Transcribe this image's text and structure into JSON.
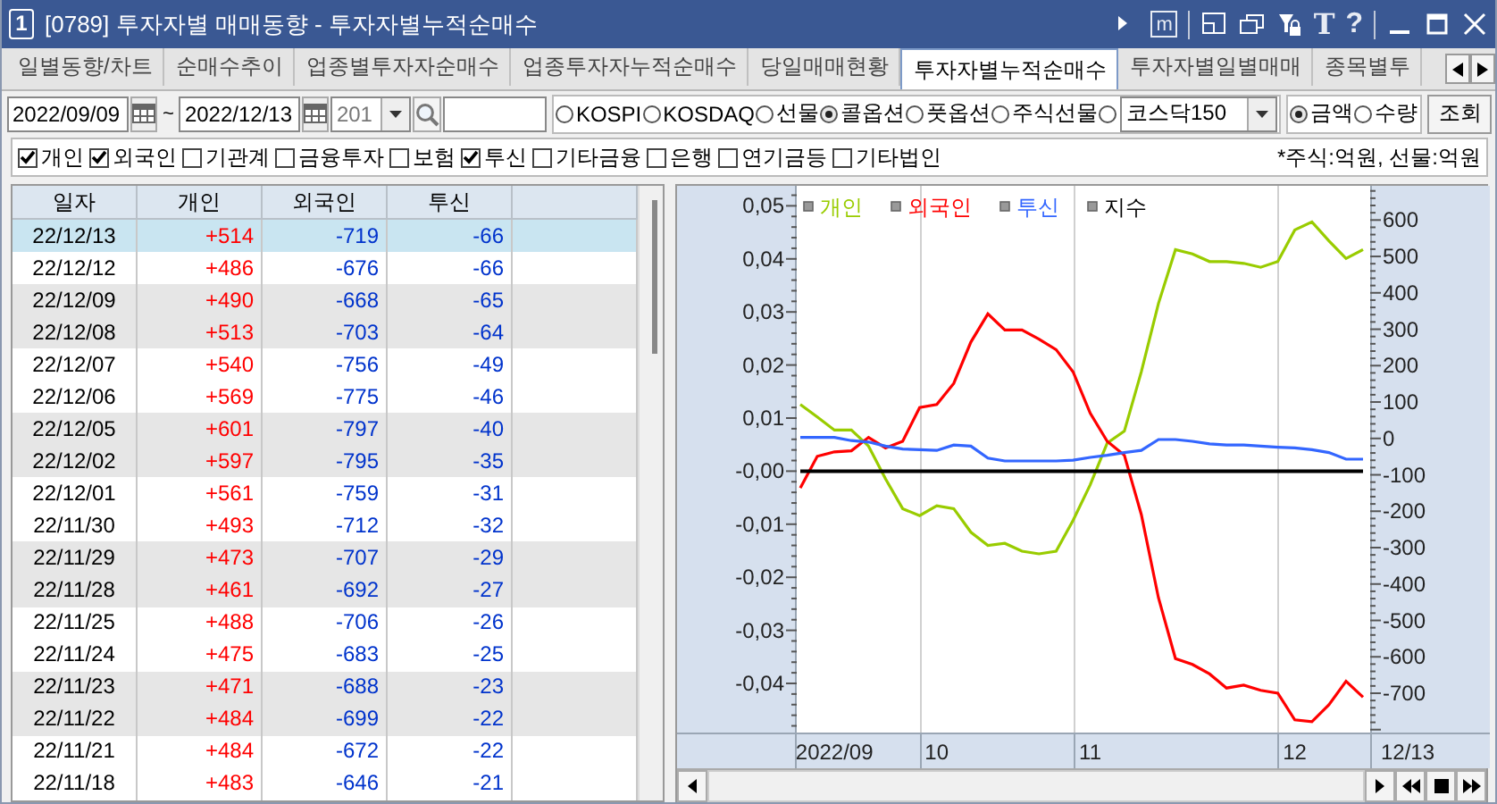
{
  "window": {
    "number": "1",
    "title": "[0789] 투자자별 매매동향 - 투자자별누적순매수",
    "tools": [
      {
        "kind": "play"
      },
      {
        "kind": "memo",
        "label": "m"
      },
      {
        "kind": "sep"
      },
      {
        "kind": "layout"
      },
      {
        "kind": "copy"
      },
      {
        "kind": "lock"
      },
      {
        "kind": "font",
        "label": "T"
      },
      {
        "kind": "help",
        "label": "?"
      },
      {
        "kind": "sep"
      },
      {
        "kind": "minimize"
      },
      {
        "kind": "maximize"
      },
      {
        "kind": "close"
      }
    ]
  },
  "tabs": [
    {
      "label": "일별동향/차트",
      "selected": false
    },
    {
      "label": "순매수추이",
      "selected": false
    },
    {
      "label": "업종별투자자순매수",
      "selected": false
    },
    {
      "label": "업종투자자누적순매수",
      "selected": false
    },
    {
      "label": "당일매매현황",
      "selected": false
    },
    {
      "label": "투자자별누적순매수",
      "selected": true
    },
    {
      "label": "투자자별일별매매",
      "selected": false
    },
    {
      "label": "종목별투",
      "selected": false
    }
  ],
  "toolbar": {
    "start_date": "2022/09/09",
    "separator": "~",
    "end_date": "2022/12/13",
    "code": "201",
    "markets": [
      {
        "label": "KOSPI",
        "selected": false
      },
      {
        "label": "KOSDAQ",
        "selected": false
      },
      {
        "label": "선물",
        "selected": false
      },
      {
        "label": "콜옵션",
        "selected": true
      },
      {
        "label": "풋옵션",
        "selected": false
      },
      {
        "label": "주식선물",
        "selected": false
      },
      {
        "kind": "combo",
        "value": "코스닥150",
        "selected": false
      }
    ],
    "units": [
      {
        "label": "금액",
        "selected": true
      },
      {
        "label": "수량",
        "selected": false
      }
    ],
    "search_button": "조회"
  },
  "investors": [
    {
      "label": "개인",
      "checked": true
    },
    {
      "label": "외국인",
      "checked": true
    },
    {
      "label": "기관계",
      "checked": false
    },
    {
      "label": "금융투자",
      "checked": false
    },
    {
      "label": "보험",
      "checked": false
    },
    {
      "label": "투신",
      "checked": true
    },
    {
      "label": "기타금융",
      "checked": false
    },
    {
      "label": "은행",
      "checked": false
    },
    {
      "label": "연기금등",
      "checked": false
    },
    {
      "label": "기타법인",
      "checked": false
    }
  ],
  "unit_note": "*주식:억원, 선물:억원",
  "table": {
    "columns": [
      {
        "label": "일자",
        "color": "#000000"
      },
      {
        "label": "개인",
        "color": "#ff0000"
      },
      {
        "label": "외국인",
        "color": "#0033cc"
      },
      {
        "label": "투신",
        "color": "#0033cc"
      }
    ],
    "rows": [
      {
        "selected": true,
        "cells": [
          "22/12/13",
          "+514",
          "-719",
          "-66"
        ]
      },
      {
        "selected": false,
        "cells": [
          "22/12/12",
          "+486",
          "-676",
          "-66"
        ]
      },
      {
        "selected": false,
        "cells": [
          "22/12/09",
          "+490",
          "-668",
          "-65"
        ]
      },
      {
        "selected": false,
        "cells": [
          "22/12/08",
          "+513",
          "-703",
          "-64"
        ]
      },
      {
        "selected": false,
        "cells": [
          "22/12/07",
          "+540",
          "-756",
          "-49"
        ]
      },
      {
        "selected": false,
        "cells": [
          "22/12/06",
          "+569",
          "-775",
          "-46"
        ]
      },
      {
        "selected": false,
        "cells": [
          "22/12/05",
          "+601",
          "-797",
          "-40"
        ]
      },
      {
        "selected": false,
        "cells": [
          "22/12/02",
          "+597",
          "-795",
          "-35"
        ]
      },
      {
        "selected": false,
        "cells": [
          "22/12/01",
          "+561",
          "-759",
          "-31"
        ]
      },
      {
        "selected": false,
        "cells": [
          "22/11/30",
          "+493",
          "-712",
          "-32"
        ]
      },
      {
        "selected": false,
        "cells": [
          "22/11/29",
          "+473",
          "-707",
          "-29"
        ]
      },
      {
        "selected": false,
        "cells": [
          "22/11/28",
          "+461",
          "-692",
          "-27"
        ]
      },
      {
        "selected": false,
        "cells": [
          "22/11/25",
          "+488",
          "-706",
          "-26"
        ]
      },
      {
        "selected": false,
        "cells": [
          "22/11/24",
          "+475",
          "-683",
          "-25"
        ]
      },
      {
        "selected": false,
        "cells": [
          "22/11/23",
          "+471",
          "-688",
          "-23"
        ]
      },
      {
        "selected": false,
        "cells": [
          "22/11/22",
          "+484",
          "-699",
          "-22"
        ]
      },
      {
        "selected": false,
        "cells": [
          "22/11/21",
          "+484",
          "-672",
          "-22"
        ]
      },
      {
        "selected": false,
        "cells": [
          "22/11/18",
          "+483",
          "-646",
          "-21"
        ]
      }
    ]
  },
  "chart": {
    "left_axis_labels": [
      "0,05",
      "0,04",
      "0,03",
      "0,02",
      "0,01",
      "-0,00",
      "-0,01",
      "-0,02",
      "-0,03",
      "-0,04"
    ],
    "end_label": "12/13",
    "chart_data": {
      "type": "line",
      "categories": [
        null,
        null,
        "2022/09",
        null,
        null,
        null,
        null,
        null,
        "10",
        null,
        null,
        null,
        null,
        null,
        null,
        null,
        null,
        "11",
        null,
        null,
        null,
        null,
        null,
        null,
        null,
        null,
        null,
        null,
        null,
        "12",
        null,
        null,
        null,
        null
      ],
      "ylim": [
        -808,
        694
      ],
      "grid": true,
      "yticks": [
        600,
        500,
        400,
        300,
        200,
        100,
        0,
        -100,
        -200,
        -300,
        -400,
        -500,
        -600,
        -700
      ],
      "series": [
        {
          "name": "개인",
          "color": "#99cc00",
          "values": [
            93,
            59,
            23,
            23,
            -21,
            -111,
            -193,
            -212,
            -185,
            -193,
            -258,
            -294,
            -288,
            -310,
            -317,
            -310,
            -225,
            -127,
            -13,
            20,
            183,
            371,
            519,
            507,
            486,
            486,
            481,
            470,
            486,
            573,
            595,
            543,
            494,
            519
          ]
        },
        {
          "name": "외국인",
          "color": "#ff0000",
          "values": [
            -136,
            -49,
            -37,
            -34,
            3,
            -26,
            -8,
            85,
            93,
            151,
            265,
            342,
            298,
            298,
            273,
            244,
            183,
            69,
            -8,
            -46,
            -209,
            -438,
            -605,
            -621,
            -647,
            -686,
            -678,
            -692,
            -700,
            -773,
            -778,
            -732,
            -667,
            -711
          ]
        },
        {
          "name": "투신",
          "color": "#3366ff",
          "values": [
            3,
            3,
            3,
            -6,
            -10,
            -21,
            -29,
            -31,
            -33,
            -18,
            -21,
            -54,
            -62,
            -62,
            -62,
            -62,
            -60,
            -52,
            -46,
            -39,
            -33,
            -3,
            -3,
            -8,
            -15,
            -18,
            -18,
            -21,
            -24,
            -26,
            -31,
            -39,
            -57,
            -57
          ]
        },
        {
          "name": "지수",
          "color": "#000000",
          "values": [
            -90,
            -90,
            -90,
            -90,
            -90,
            -90,
            -90,
            -90,
            -90,
            -90,
            -90,
            -90,
            -90,
            -90,
            -90,
            -90,
            -90,
            -90,
            -90,
            -90,
            -90,
            -90,
            -90,
            -90,
            -90,
            -90,
            -90,
            -90,
            -90,
            -90,
            -90,
            -90,
            -90,
            -90
          ]
        }
      ]
    }
  }
}
